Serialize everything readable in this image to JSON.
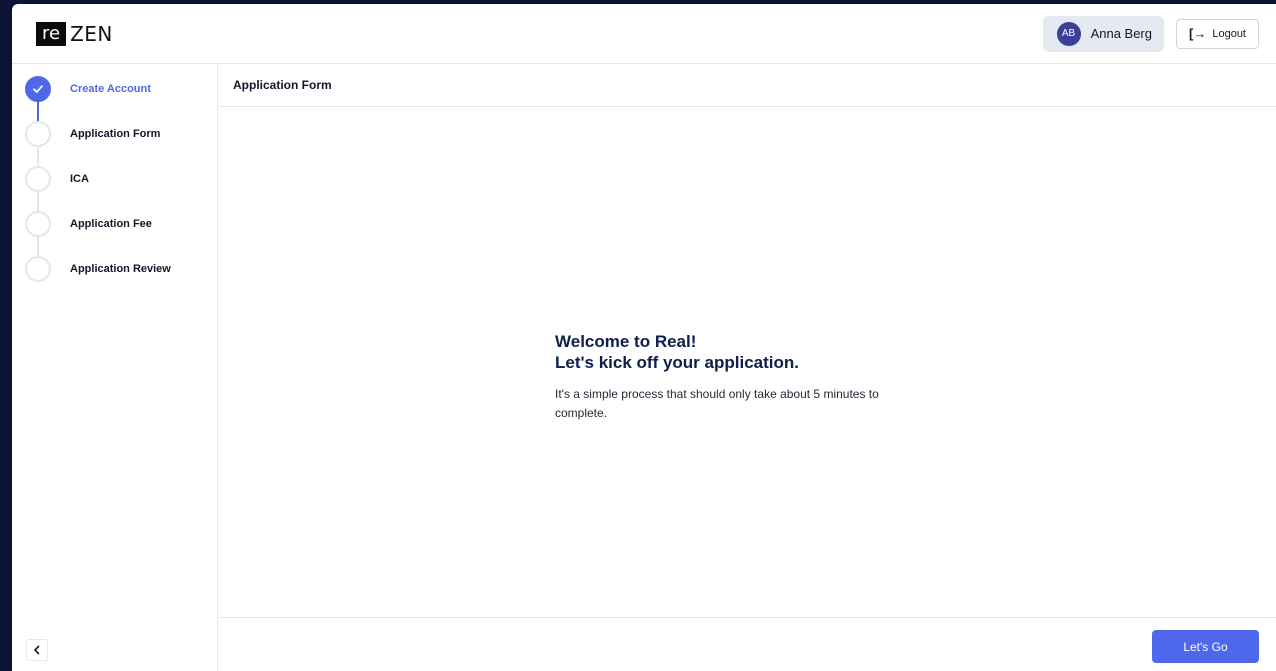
{
  "brand": {
    "logo_box": "re",
    "logo_text": "ZEN"
  },
  "header": {
    "user": {
      "initials": "AB",
      "name": "Anna Berg"
    },
    "logout_label": "Logout"
  },
  "steps": [
    {
      "label": "Create Account",
      "status": "completed"
    },
    {
      "label": "Application Form",
      "status": "pending"
    },
    {
      "label": "ICA",
      "status": "pending"
    },
    {
      "label": "Application Fee",
      "status": "pending"
    },
    {
      "label": "Application Review",
      "status": "pending"
    }
  ],
  "main": {
    "title": "Application Form",
    "welcome_line1": "Welcome to Real!",
    "welcome_line2": "Let's kick off your application.",
    "description": "It's a simple process that should only take about 5 minutes to complete.",
    "cta_label": "Let's Go"
  },
  "colors": {
    "accent": "#4f67ea",
    "frame": "#0b1437",
    "avatar": "#3b3f98"
  }
}
